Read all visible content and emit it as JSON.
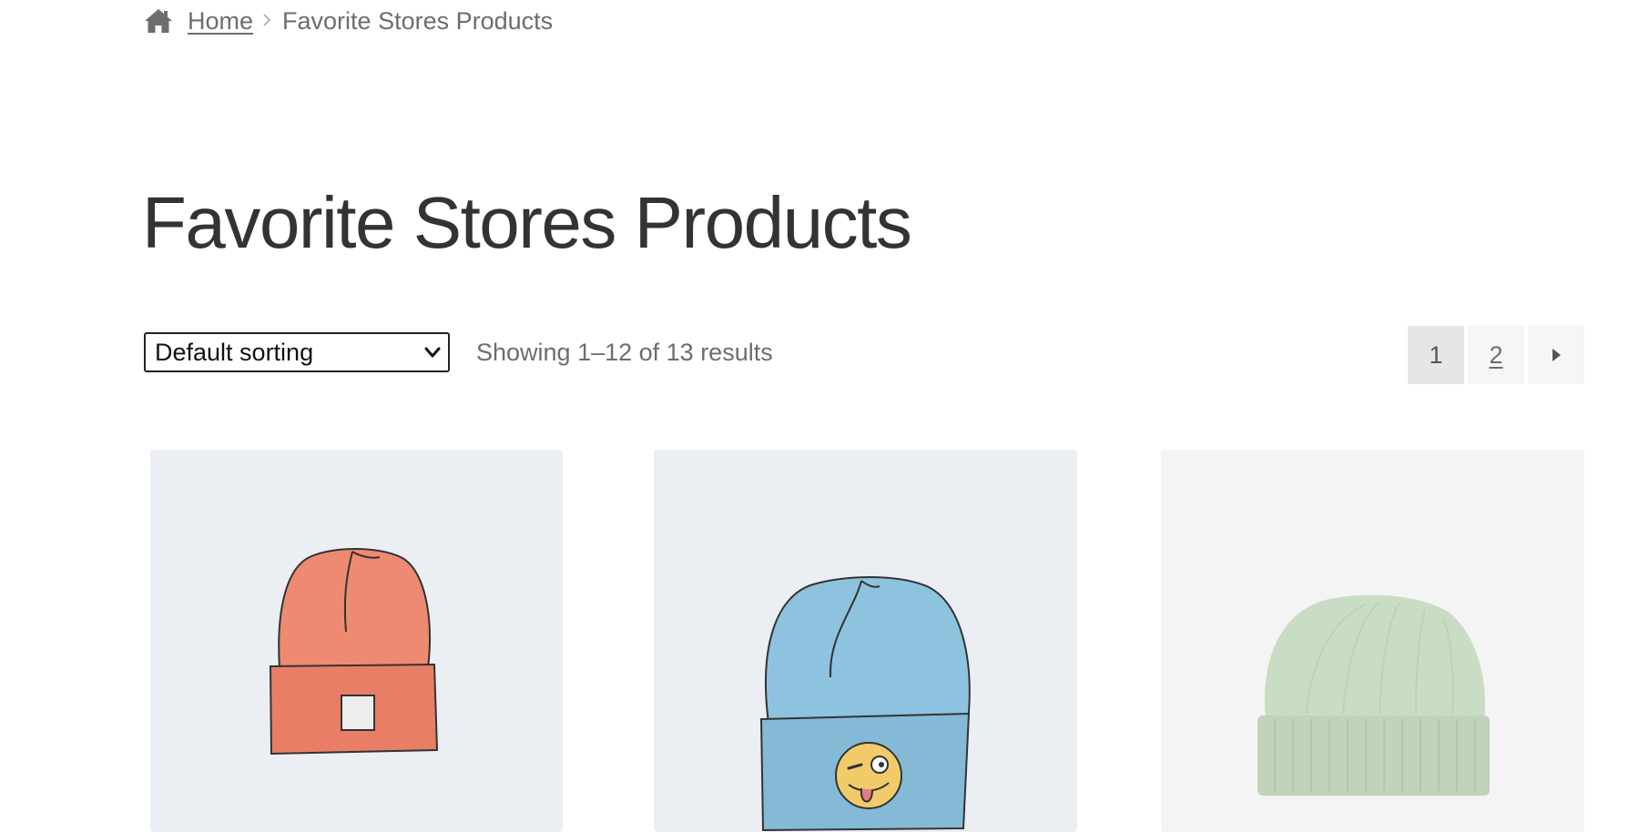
{
  "breadcrumb": {
    "home_icon": "home-icon",
    "home_label": "Home",
    "separator_icon": "chevron-right-icon",
    "current": "Favorite Stores Products"
  },
  "page": {
    "title": "Favorite Stores Products"
  },
  "toolbar": {
    "sort_selected": "Default sorting",
    "sort_icon": "chevron-down-icon",
    "result_count": "Showing 1–12 of 13 results"
  },
  "pagination": {
    "pages": [
      "1",
      "2"
    ],
    "current": "1",
    "next_icon": "caret-right-icon"
  },
  "products": [
    {
      "image": "orange beanie with square patch",
      "color": "#ee8a72"
    },
    {
      "image": "light blue beanie with winking emoji patch",
      "color": "#8dc3de"
    },
    {
      "image": "mint green knit beanie",
      "color": "#c9dcc4"
    }
  ],
  "colors": {
    "text": "#333333",
    "muted": "#6d6d6d",
    "card_bg": "#ebeef2"
  }
}
